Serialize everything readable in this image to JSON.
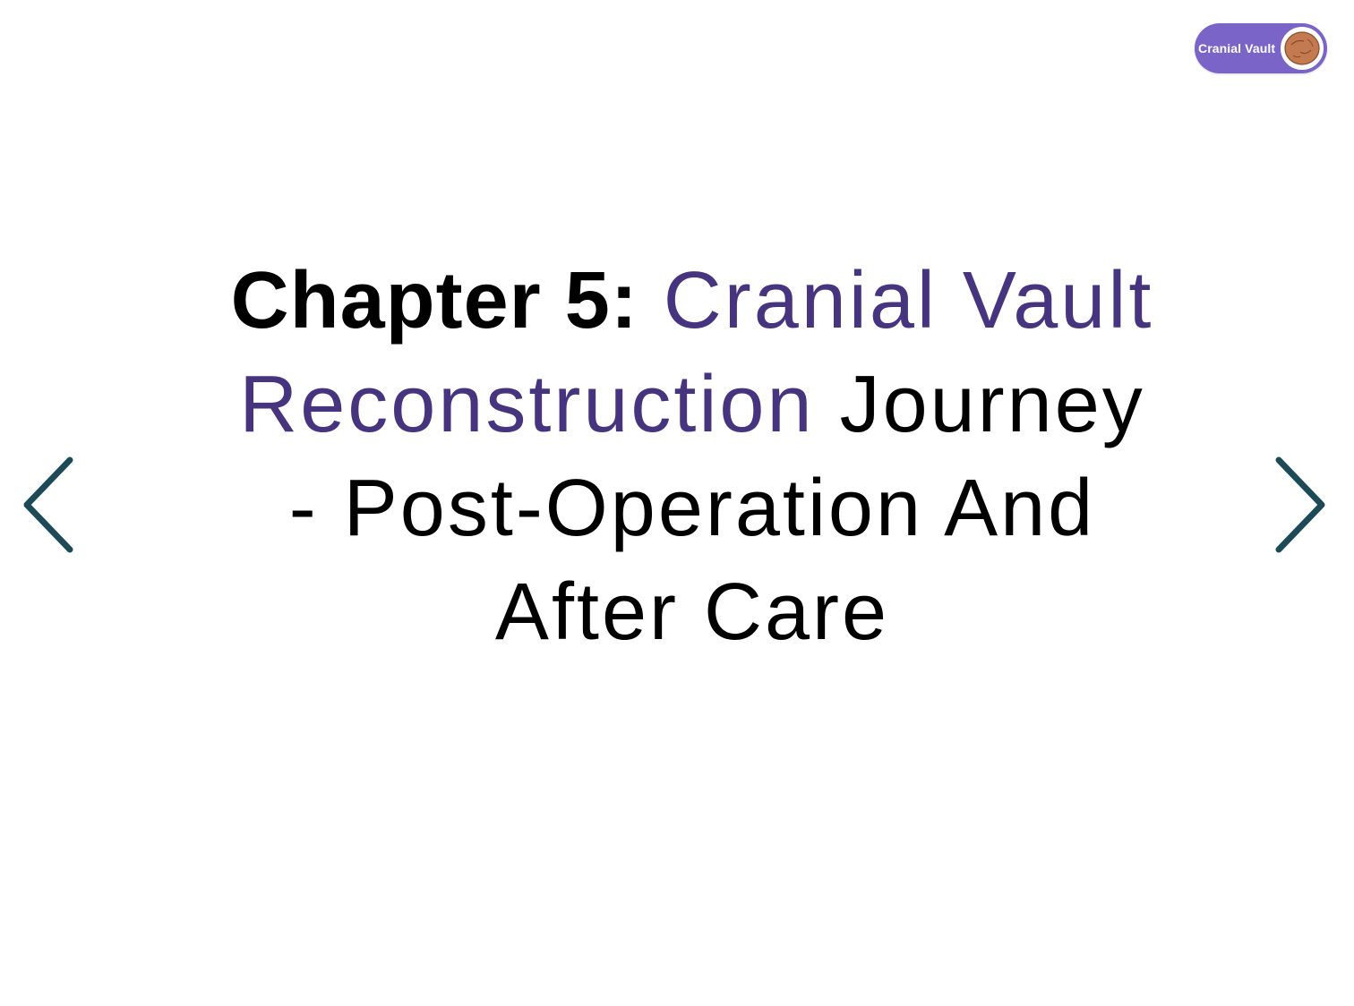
{
  "colors": {
    "accent": "#47347f",
    "badge": "#7a64c8",
    "chevron": "#1d4a57",
    "text": "#000000",
    "background": "#ffffff"
  },
  "badge": {
    "label": "Cranial Vault",
    "avatar_icon": "skull-avatar-icon"
  },
  "slide": {
    "chapter_label": "Chapter 5:",
    "title_accent": "Cranial Vault Reconstruction",
    "title_rest": "Journey - Post-Operation And After Care"
  },
  "navigation": {
    "prev_icon": "chevron-left-icon",
    "next_icon": "chevron-right-icon"
  }
}
